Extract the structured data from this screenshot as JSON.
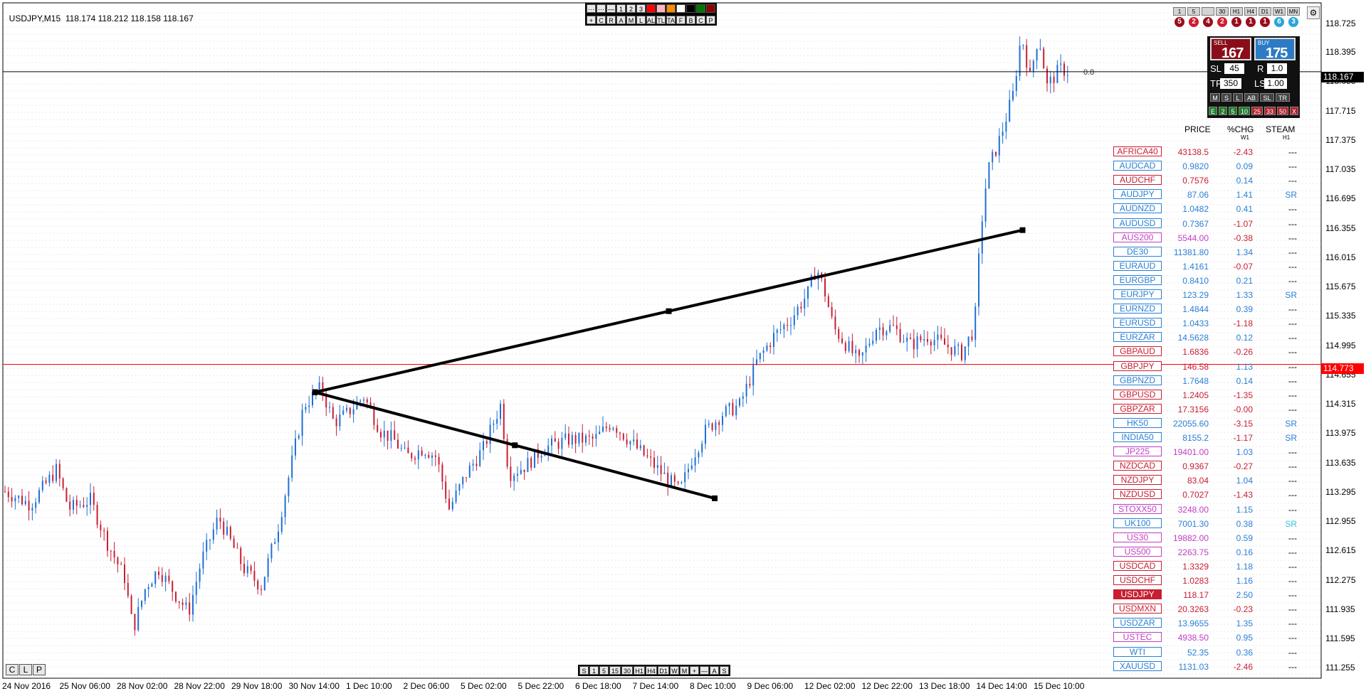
{
  "header": {
    "symbol": "USDJPY,M15",
    "prices": "118.174 118.212 118.158 118.167"
  },
  "colors": {
    "bull": "#1e6fd6",
    "bear": "#c81e32",
    "grid": "#c9d3de",
    "trend": "#000000",
    "current_line": "#000000",
    "alert_line": "#ff0000"
  },
  "top_toolbar": {
    "row1": [
      "⋯",
      "⋯",
      "—",
      "1",
      "2",
      "3",
      "",
      "",
      "",
      "",
      "",
      "",
      ""
    ],
    "row2": [
      "+",
      "C",
      "R",
      "A",
      "M",
      "L",
      "AL",
      "TL",
      "TA",
      "F",
      "B",
      "C",
      "P"
    ]
  },
  "timeframes": {
    "labels": [
      "1",
      "5",
      "",
      "30",
      "H1",
      "H4",
      "D1",
      "W1",
      "MN"
    ],
    "badges": [
      "5",
      "2",
      "4",
      "2",
      "1",
      "1",
      "1",
      "6",
      "3"
    ],
    "badge_colors": [
      "#9b0d1e",
      "#d01c2e",
      "#9b0d1e",
      "#d01c2e",
      "#9b0d1e",
      "#9b0d1e",
      "#9b0d1e",
      "#2aa5d8",
      "#2aa5d8"
    ]
  },
  "trade_panel": {
    "sell_label": "SELL",
    "sell_price": "167",
    "buy_label": "BUY",
    "buy_price": "175",
    "sl_label": "SL",
    "sl_value": "45",
    "r_label": "R",
    "r_value": "1.0",
    "tp_label": "TP",
    "tp_value": "350",
    "ls_label": "LS",
    "ls_value": "1.00",
    "row1_buttons": [
      "M",
      "S",
      "L",
      "AB",
      "SL",
      "TR"
    ],
    "row2_buttons": [
      "E",
      "2",
      "5",
      "10",
      "25",
      "33",
      "50",
      "X"
    ]
  },
  "watchlist": {
    "headers": {
      "price": "PRICE",
      "chg": "%CHG",
      "chg_sub": "W1",
      "steam": "STEAM",
      "steam_sub": "H1"
    },
    "rows": [
      {
        "sym": "AFRICA40",
        "price": "43138.5",
        "chg": "-2.43",
        "steam": "---",
        "c": "#c81e32",
        "steam_c": "#000"
      },
      {
        "sym": "AUDCAD",
        "price": "0.9820",
        "chg": "0.09",
        "steam": "---",
        "c": "#2a7fd4",
        "steam_c": "#000"
      },
      {
        "sym": "AUDCHF",
        "price": "0.7576",
        "chg": "0.14",
        "steam": "---",
        "c": "#c81e32",
        "steam_c": "#000"
      },
      {
        "sym": "AUDJPY",
        "price": "87.06",
        "chg": "1.41",
        "steam": "SR",
        "c": "#2a7fd4",
        "steam_c": "#2a7fd4"
      },
      {
        "sym": "AUDNZD",
        "price": "1.0482",
        "chg": "0.41",
        "steam": "---",
        "c": "#2a7fd4",
        "steam_c": "#000"
      },
      {
        "sym": "AUDUSD",
        "price": "0.7367",
        "chg": "-1.07",
        "steam": "---",
        "c": "#2a7fd4",
        "steam_c": "#000"
      },
      {
        "sym": "AUS200",
        "price": "5544.00",
        "chg": "-0.38",
        "steam": "---",
        "c": "#c040c0",
        "steam_c": "#000"
      },
      {
        "sym": "DE30",
        "price": "11381.80",
        "chg": "1.34",
        "steam": "---",
        "c": "#2a7fd4",
        "steam_c": "#000"
      },
      {
        "sym": "EURAUD",
        "price": "1.4161",
        "chg": "-0.07",
        "steam": "---",
        "c": "#2a7fd4",
        "steam_c": "#000"
      },
      {
        "sym": "EURGBP",
        "price": "0.8410",
        "chg": "0.21",
        "steam": "---",
        "c": "#2a7fd4",
        "steam_c": "#000"
      },
      {
        "sym": "EURJPY",
        "price": "123.29",
        "chg": "1.33",
        "steam": "SR",
        "c": "#2a7fd4",
        "steam_c": "#2a7fd4"
      },
      {
        "sym": "EURNZD",
        "price": "1.4844",
        "chg": "0.39",
        "steam": "---",
        "c": "#2a7fd4",
        "steam_c": "#000"
      },
      {
        "sym": "EURUSD",
        "price": "1.0433",
        "chg": "-1.18",
        "steam": "---",
        "c": "#2a7fd4",
        "steam_c": "#000"
      },
      {
        "sym": "EURZAR",
        "price": "14.5628",
        "chg": "0.12",
        "steam": "---",
        "c": "#2a7fd4",
        "steam_c": "#000"
      },
      {
        "sym": "GBPAUD",
        "price": "1.6836",
        "chg": "-0.26",
        "steam": "---",
        "c": "#c81e32",
        "steam_c": "#000"
      },
      {
        "sym": "GBPJPY",
        "price": "146.58",
        "chg": "1.13",
        "steam": "---",
        "c": "#c81e32",
        "steam_c": "#000"
      },
      {
        "sym": "GBPNZD",
        "price": "1.7648",
        "chg": "0.14",
        "steam": "---",
        "c": "#2a7fd4",
        "steam_c": "#000"
      },
      {
        "sym": "GBPUSD",
        "price": "1.2405",
        "chg": "-1.35",
        "steam": "---",
        "c": "#c81e32",
        "steam_c": "#000"
      },
      {
        "sym": "GBPZAR",
        "price": "17.3156",
        "chg": "-0.00",
        "steam": "---",
        "c": "#c81e32",
        "steam_c": "#000"
      },
      {
        "sym": "HK50",
        "price": "22055.60",
        "chg": "-3.15",
        "steam": "SR",
        "c": "#2a7fd4",
        "steam_c": "#2a7fd4"
      },
      {
        "sym": "INDIA50",
        "price": "8155.2",
        "chg": "-1.17",
        "steam": "SR",
        "c": "#2a7fd4",
        "steam_c": "#2a7fd4"
      },
      {
        "sym": "JP225",
        "price": "19401.00",
        "chg": "1.03",
        "steam": "---",
        "c": "#c040c0",
        "steam_c": "#000"
      },
      {
        "sym": "NZDCAD",
        "price": "0.9367",
        "chg": "-0.27",
        "steam": "---",
        "c": "#c81e32",
        "steam_c": "#000"
      },
      {
        "sym": "NZDJPY",
        "price": "83.04",
        "chg": "1.04",
        "steam": "---",
        "c": "#c81e32",
        "steam_c": "#000"
      },
      {
        "sym": "NZDUSD",
        "price": "0.7027",
        "chg": "-1.43",
        "steam": "---",
        "c": "#c81e32",
        "steam_c": "#000"
      },
      {
        "sym": "STOXX50",
        "price": "3248.00",
        "chg": "1.15",
        "steam": "---",
        "c": "#c040c0",
        "steam_c": "#000"
      },
      {
        "sym": "UK100",
        "price": "7001.30",
        "chg": "0.38",
        "steam": "SR",
        "c": "#2a7fd4",
        "steam_c": "#33c6e0"
      },
      {
        "sym": "US30",
        "price": "19882.00",
        "chg": "0.59",
        "steam": "---",
        "c": "#c040c0",
        "steam_c": "#000"
      },
      {
        "sym": "US500",
        "price": "2263.75",
        "chg": "0.16",
        "steam": "---",
        "c": "#c040c0",
        "steam_c": "#000"
      },
      {
        "sym": "USDCAD",
        "price": "1.3329",
        "chg": "1.18",
        "steam": "---",
        "c": "#c81e32",
        "steam_c": "#000"
      },
      {
        "sym": "USDCHF",
        "price": "1.0283",
        "chg": "1.16",
        "steam": "---",
        "c": "#c81e32",
        "steam_c": "#000"
      },
      {
        "sym": "USDJPY",
        "price": "118.17",
        "chg": "2.50",
        "steam": "---",
        "c": "#c81e32",
        "steam_c": "#000",
        "selected": true
      },
      {
        "sym": "USDMXN",
        "price": "20.3263",
        "chg": "-0.23",
        "steam": "---",
        "c": "#c81e32",
        "steam_c": "#000"
      },
      {
        "sym": "USDZAR",
        "price": "13.9655",
        "chg": "1.35",
        "steam": "---",
        "c": "#2a7fd4",
        "steam_c": "#000"
      },
      {
        "sym": "USTEC",
        "price": "4938.50",
        "chg": "0.95",
        "steam": "---",
        "c": "#c040c0",
        "steam_c": "#000"
      },
      {
        "sym": "WTI",
        "price": "52.35",
        "chg": "0.36",
        "steam": "---",
        "c": "#2a7fd4",
        "steam_c": "#000"
      },
      {
        "sym": "XAUUSD",
        "price": "1131.03",
        "chg": "-2.46",
        "steam": "---",
        "c": "#2a7fd4",
        "steam_c": "#000"
      }
    ]
  },
  "bottom_toolbar": [
    "S",
    "1",
    "5",
    "15",
    "30",
    "H1",
    "H4",
    "D1",
    "W",
    "M",
    "+",
    "—",
    "A",
    "S"
  ],
  "mode_buttons": [
    "C",
    "L",
    "P"
  ],
  "price_axis": [
    "118.725",
    "118.395",
    "118.055",
    "117.715",
    "117.375",
    "117.035",
    "116.695",
    "116.355",
    "116.015",
    "115.675",
    "115.335",
    "114.995",
    "114.655",
    "114.315",
    "113.975",
    "113.635",
    "113.295",
    "112.955",
    "112.615",
    "112.275",
    "111.935",
    "111.595",
    "111.255"
  ],
  "current_price_tag": "118.167",
  "alert_price_tag": "114.773",
  "fib_label": "0.8",
  "chart_data": {
    "type": "candlestick",
    "symbol": "USDJPY",
    "timeframe": "M15",
    "x_tick_labels": [
      "24 Nov 2016",
      "25 Nov 06:00",
      "28 Nov 02:00",
      "28 Nov 22:00",
      "29 Nov 18:00",
      "30 Nov 14:00",
      "1 Dec 10:00",
      "2 Dec 06:00",
      "5 Dec 02:00",
      "5 Dec 22:00",
      "6 Dec 18:00",
      "7 Dec 14:00",
      "8 Dec 10:00",
      "9 Dec 06:00",
      "12 Dec 02:00",
      "12 Dec 22:00",
      "13 Dec 18:00",
      "14 Dec 14:00",
      "15 Dec 10:00"
    ],
    "ylim": [
      111.15,
      118.85
    ],
    "last_price": 118.167,
    "alert_level": 114.773,
    "close_path": [
      [
        0,
        113.3
      ],
      [
        30,
        113.15
      ],
      [
        60,
        113.55
      ],
      [
        75,
        113.1
      ],
      [
        100,
        113.2
      ],
      [
        120,
        112.7
      ],
      [
        140,
        112.3
      ],
      [
        150,
        111.7
      ],
      [
        165,
        112.2
      ],
      [
        180,
        112.4
      ],
      [
        200,
        112.1
      ],
      [
        215,
        111.9
      ],
      [
        230,
        112.5
      ],
      [
        250,
        113.0
      ],
      [
        265,
        112.7
      ],
      [
        280,
        112.4
      ],
      [
        300,
        112.2
      ],
      [
        320,
        112.9
      ],
      [
        335,
        113.6
      ],
      [
        350,
        114.3
      ],
      [
        370,
        114.5
      ],
      [
        385,
        114.1
      ],
      [
        400,
        114.2
      ],
      [
        420,
        114.4
      ],
      [
        440,
        114.0
      ],
      [
        455,
        113.9
      ],
      [
        470,
        113.7
      ],
      [
        490,
        113.8
      ],
      [
        505,
        113.7
      ],
      [
        520,
        113.1
      ],
      [
        540,
        113.5
      ],
      [
        560,
        113.8
      ],
      [
        580,
        114.3
      ],
      [
        590,
        113.5
      ],
      [
        610,
        113.6
      ],
      [
        630,
        113.8
      ],
      [
        660,
        113.9
      ],
      [
        690,
        113.9
      ],
      [
        710,
        114.1
      ],
      [
        730,
        113.9
      ],
      [
        750,
        113.7
      ],
      [
        770,
        113.5
      ],
      [
        790,
        113.3
      ],
      [
        805,
        113.7
      ],
      [
        820,
        114.0
      ],
      [
        840,
        114.2
      ],
      [
        860,
        114.3
      ],
      [
        880,
        114.8
      ],
      [
        900,
        115.1
      ],
      [
        920,
        115.3
      ],
      [
        940,
        115.6
      ],
      [
        950,
        115.9
      ],
      [
        960,
        115.6
      ],
      [
        970,
        115.2
      ],
      [
        985,
        115.0
      ],
      [
        1000,
        114.8
      ],
      [
        1020,
        115.2
      ],
      [
        1040,
        115.2
      ],
      [
        1060,
        115.0
      ],
      [
        1080,
        115.1
      ],
      [
        1100,
        115.0
      ],
      [
        1120,
        114.9
      ],
      [
        1135,
        115.2
      ],
      [
        1142,
        116.3
      ],
      [
        1150,
        117.0
      ],
      [
        1165,
        117.4
      ],
      [
        1180,
        117.9
      ],
      [
        1190,
        118.6
      ],
      [
        1200,
        118.1
      ],
      [
        1210,
        118.6
      ],
      [
        1220,
        118.0
      ],
      [
        1235,
        118.2
      ],
      [
        1245,
        118.17
      ]
    ],
    "trendlines": [
      {
        "from": {
          "x": "30 Nov 14:00",
          "price": 114.45
        },
        "to": {
          "x": "14 Dec 14:00",
          "price": 116.33
        }
      },
      {
        "from": {
          "x": "30 Nov 14:00",
          "price": 114.45
        },
        "to": {
          "x": "8 Dec 10:00",
          "price": 113.22
        }
      }
    ]
  }
}
